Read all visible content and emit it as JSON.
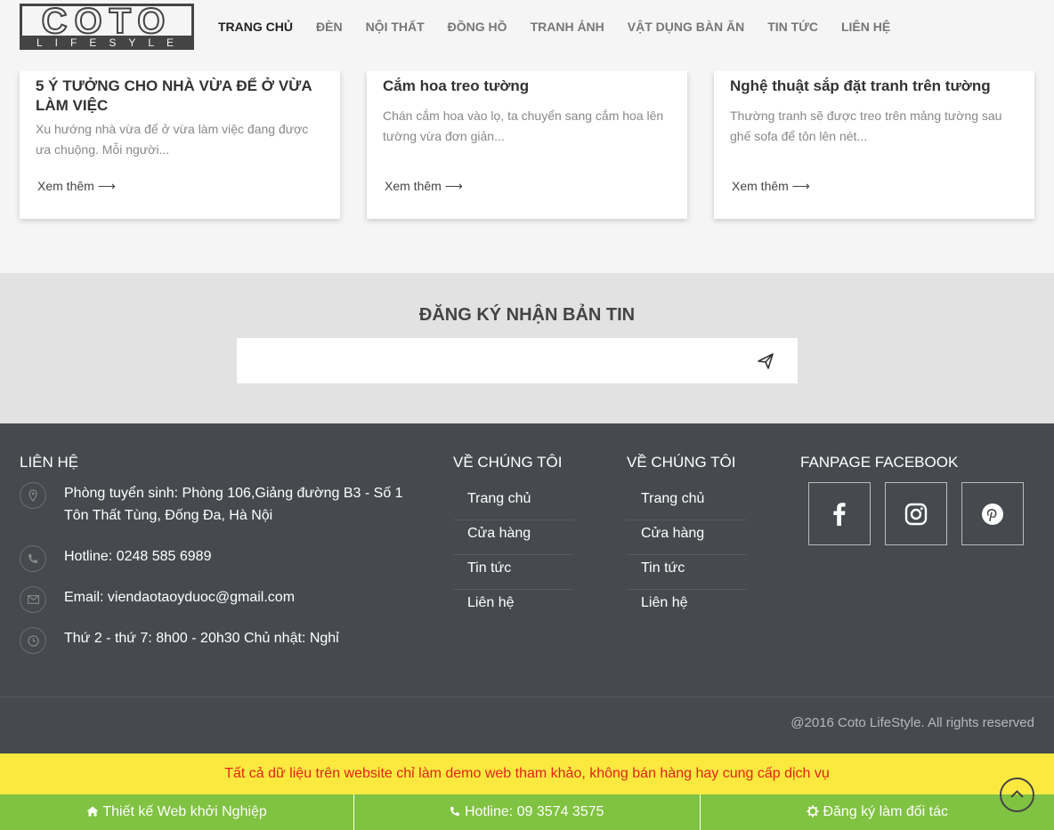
{
  "header": {
    "logo_top": "COTO",
    "logo_bottom": "LIFESYLE",
    "nav": [
      {
        "label": "TRANG CHỦ",
        "active": true
      },
      {
        "label": "ĐÈN"
      },
      {
        "label": "NỘI THẤT"
      },
      {
        "label": "ĐỒNG HỒ"
      },
      {
        "label": "TRANH ẢNH"
      },
      {
        "label": "VẬT DỤNG BÀN ĂN"
      },
      {
        "label": "TIN TỨC"
      },
      {
        "label": "LIÊN HỆ"
      }
    ]
  },
  "posts": [
    {
      "title": "5 Ý TƯỞNG CHO NHÀ VỪA ĐỂ Ở VỪA LÀM VIỆC",
      "desc": "Xu hướng nhà vừa để ở vừa làm việc đang được ưa chuộng. Mỗi người...",
      "more": "Xem thêm ⟶"
    },
    {
      "title": "Cắm hoa treo tường",
      "desc": "Chán cắm hoa vào lọ, ta chuyển sang cắm hoa lên tường vừa đơn giản...",
      "more": "Xem thêm ⟶"
    },
    {
      "title": "Nghệ thuật sắp đặt tranh trên tường",
      "desc": "Thường tranh sẽ được treo trên mảng tường sau ghế sofa để tôn lên nét...",
      "more": "Xem thêm ⟶"
    }
  ],
  "newsletter": {
    "title": "ĐĂNG KÝ NHẬN BẢN TIN",
    "placeholder": ""
  },
  "footer": {
    "contact_heading": "LIÊN HỆ",
    "contact": {
      "address": "Phòng tuyển sinh: Phòng 106,Giảng đường B3 - Số 1 Tôn Thất Tùng, Đống Đa, Hà Nội",
      "hotline": "Hotline: 0248 585 6989",
      "email": "Email: viendaotaoyduoc@gmail.com",
      "hours": "Thứ 2 - thứ 7: 8h00 - 20h30 Chủ nhật: Nghỉ"
    },
    "about1": {
      "heading": "VỀ CHÚNG TÔI",
      "links": [
        "Trang chủ",
        "Cửa hàng",
        "Tin tức",
        "Liên hệ"
      ]
    },
    "about2": {
      "heading": "VỀ CHÚNG TÔI",
      "links": [
        "Trang chủ",
        "Cửa hàng",
        "Tin tức",
        "Liên hệ"
      ]
    },
    "fanpage_heading": "FANPAGE FACEBOOK",
    "social_icons": [
      "facebook-icon",
      "instagram-icon",
      "pinterest-icon"
    ],
    "copyright": "@2016 Coto LifeStyle. All rights reserved"
  },
  "notice": "Tất cả dữ liệu trên website chỉ làm demo web tham khảo, không bán hàng hay cung cấp dịch vụ",
  "bottom_bar": {
    "item1": "Thiết kế Web khởi Nghiệp",
    "item2": "Hotline: 09 3574 3575",
    "item3": "Đăng ký làm đối tác"
  },
  "colors": {
    "footer_bg": "#464a4e",
    "newsletter_bg": "#e2e2e2",
    "notice_bg": "#fce940",
    "notice_text": "#e2231a",
    "bottom_bar_bg": "#80c241"
  }
}
